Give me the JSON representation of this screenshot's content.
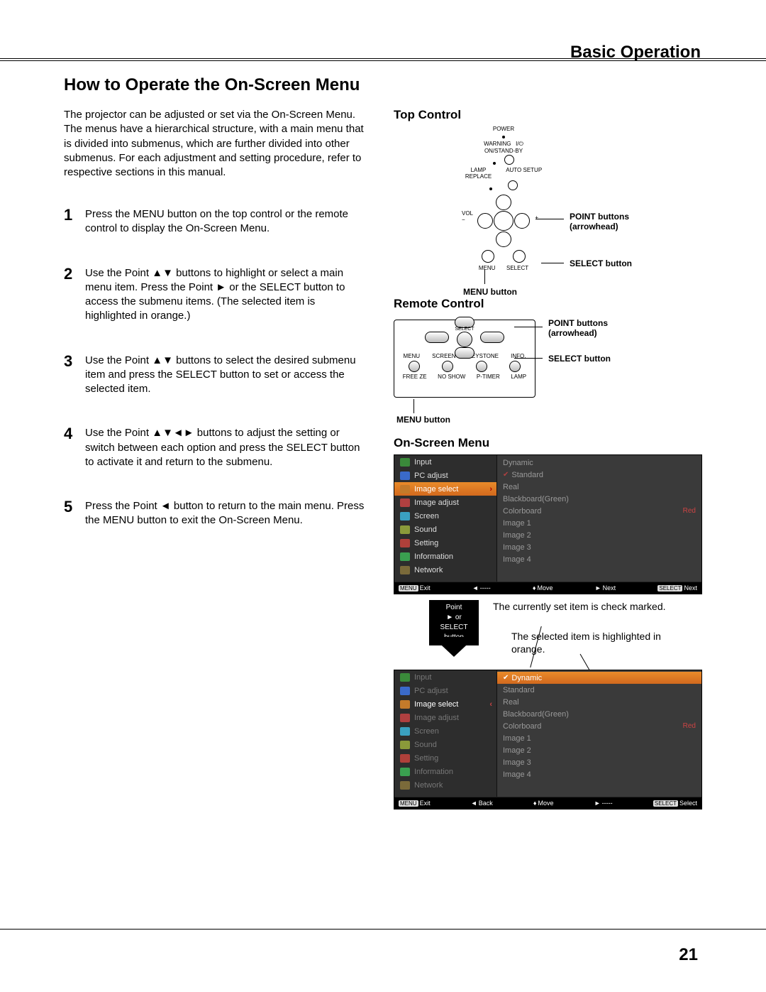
{
  "header": {
    "section": "Basic Operation"
  },
  "title": "How to Operate the On-Screen Menu",
  "intro": "The projector can be adjusted or set via the On-Screen Menu. The menus have a hierarchical structure, with a main menu that is divided into submenus, which are further divided into other submenus. For each adjustment and setting procedure, refer to respective sections in this manual.",
  "steps": [
    {
      "num": "1",
      "text": "Press the MENU button on the top control or the remote control to display the On-Screen Menu."
    },
    {
      "num": "2",
      "text": "Use the Point ▲▼ buttons to highlight or select a main menu item. Press the Point ► or the SELECT button to access the submenu items. (The selected item is highlighted in orange.)"
    },
    {
      "num": "3",
      "text": "Use the Point ▲▼ buttons to select the desired submenu item and press the SELECT button to set or access the selected item."
    },
    {
      "num": "4",
      "text": "Use the Point ▲▼◄► buttons to adjust the setting or switch between each option and press the SELECT button to activate it and return to the submenu."
    },
    {
      "num": "5",
      "text": "Press the Point ◄ button to return to the main menu. Press the MENU button to exit the On-Screen Menu."
    }
  ],
  "top_control": {
    "title": "Top Control",
    "labels": {
      "power": "POWER",
      "warning": "WARNING",
      "onstandby": "ON/STAND-BY",
      "lamp_replace": "LAMP\nREPLACE",
      "autosetup": "AUTO SETUP",
      "vol": "VOL",
      "menu": "MENU",
      "select": "SELECT"
    },
    "callouts": {
      "point_buttons": "POINT buttons (arrowhead)",
      "select_button": "SELECT button",
      "menu_button": "MENU button"
    }
  },
  "remote_control": {
    "title": "Remote Control",
    "row_labels": {
      "menu": "MENU",
      "screen": "SCREEN",
      "keystone": "KEYSTONE",
      "info": "INFO.",
      "freeze": "FREE ZE",
      "noshow": "NO SHOW",
      "ptimer": "P-TIMER",
      "lamp": "LAMP",
      "select": "SELECT"
    },
    "callouts": {
      "point_buttons": "POINT buttons (arrowhead)",
      "select_button": "SELECT button",
      "menu_button": "MENU button"
    }
  },
  "osm": {
    "title": "On-Screen Menu",
    "menu_items": [
      {
        "label": "Input",
        "icon": "mi-input"
      },
      {
        "label": "PC adjust",
        "icon": "mi-pc"
      },
      {
        "label": "Image select",
        "icon": "mi-sel",
        "selected": true
      },
      {
        "label": "Image adjust",
        "icon": "mi-adj"
      },
      {
        "label": "Screen",
        "icon": "mi-scr"
      },
      {
        "label": "Sound",
        "icon": "mi-snd"
      },
      {
        "label": "Setting",
        "icon": "mi-set"
      },
      {
        "label": "Information",
        "icon": "mi-info"
      },
      {
        "label": "Network",
        "icon": "mi-net"
      }
    ],
    "options": [
      {
        "label": "Dynamic"
      },
      {
        "label": "Standard",
        "checked": true
      },
      {
        "label": "Real"
      },
      {
        "label": "Blackboard(Green)"
      },
      {
        "label": "Colorboard",
        "badge": "Red"
      },
      {
        "label": "Image 1"
      },
      {
        "label": "Image 2"
      },
      {
        "label": "Image 3"
      },
      {
        "label": "Image 4"
      }
    ],
    "statusbar1": {
      "exit": "Exit",
      "exit_btn": "MENU",
      "back": "-----",
      "move": "Move",
      "next": "Next",
      "select_btn": "SELECT",
      "select": "Next"
    },
    "between": {
      "point_card_l1": "Point",
      "point_card_l2": "► or SELECT",
      "point_card_l3": "button",
      "text1": "The currently set item is check marked.",
      "text2": "The selected item is highlighted in orange."
    },
    "panel2_selected_opt": "Dynamic",
    "statusbar2": {
      "exit": "Exit",
      "exit_btn": "MENU",
      "back": "Back",
      "move": "Move",
      "next": "-----",
      "select_btn": "SELECT",
      "select": "Select"
    }
  },
  "page_number": "21"
}
